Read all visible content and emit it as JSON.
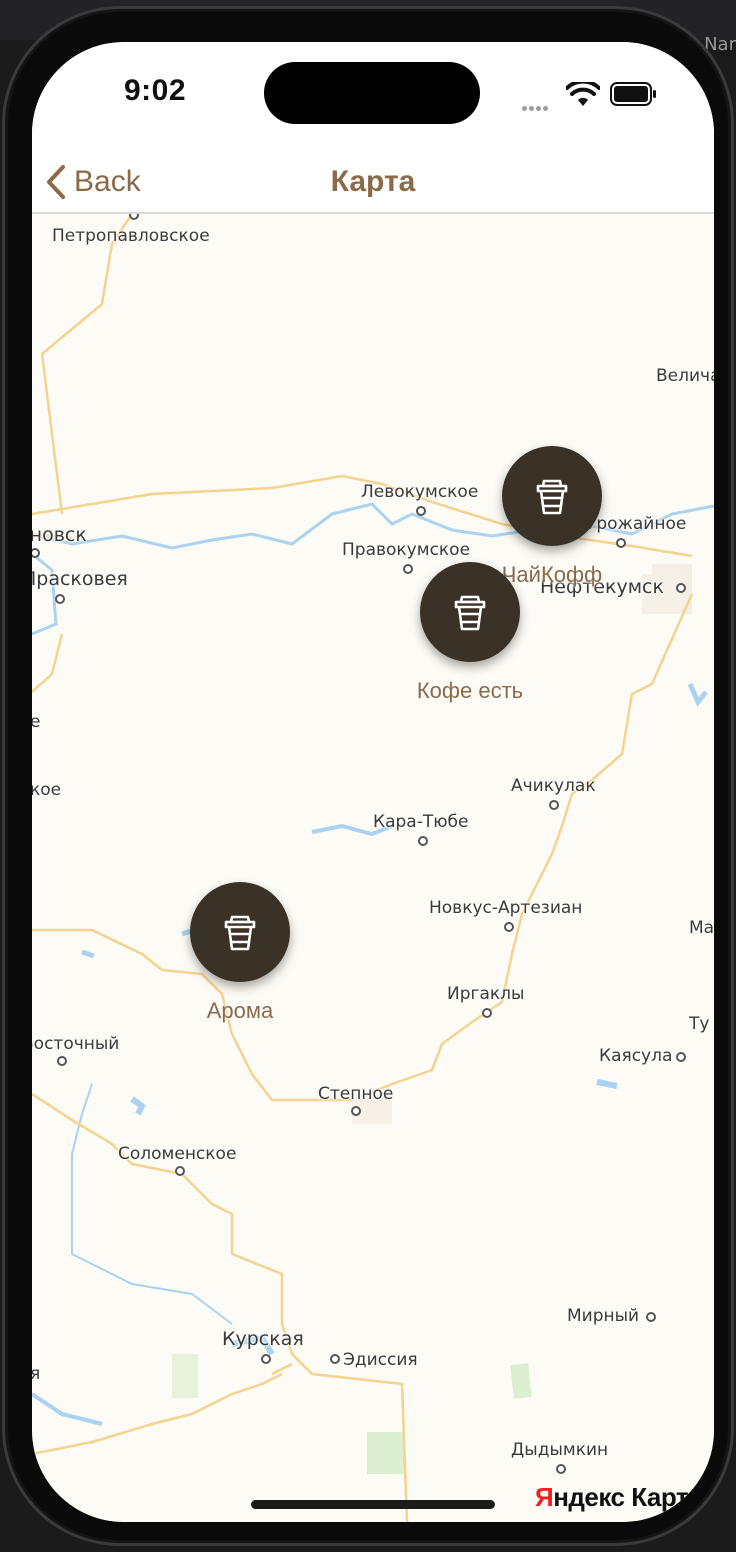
{
  "background": {
    "right_edge_fragment": "Nar"
  },
  "status_bar": {
    "time": "9:02"
  },
  "nav": {
    "back_label": "Back",
    "title": "Карта"
  },
  "map": {
    "places": {
      "petropavlovskoe": "Петропавловское",
      "velicha": "Велича",
      "levokumskoe": "Левокумское",
      "pravokumskoe": "Правокумское",
      "novsk": "ановск",
      "praskoveya": "Прасковея",
      "urozhaynoe": "Урожайное",
      "neftekumsk": "Нефтекумск",
      "e_frag": "е",
      "koe_frag": "кое",
      "achikulak": "Ачикулак",
      "kara_tyube": "Кара-Тюбе",
      "novkus_artezian": "Новкус-Артезиан",
      "ma_frag": "Ма",
      "irgakly": "Иргаклы",
      "tu_frag": "Ту",
      "vostochny": "Восточный",
      "kayasula": "Каясула",
      "stepnoe": "Степное",
      "solomenskoe": "Соломенское",
      "mirny": "Мирный",
      "kurskaya": "Курская",
      "edissiya": "Эдиссия",
      "ya_frag": "я",
      "dydymkin": "Дыдымкин"
    },
    "pins": [
      {
        "label": "ЧайКофф",
        "icon": "coffee-cup-icon"
      },
      {
        "label": "Кофе есть",
        "icon": "coffee-cup-icon"
      },
      {
        "label": "Арома",
        "icon": "coffee-cup-icon"
      }
    ],
    "attribution": {
      "ya": "Я",
      "rest": "ндекс Карты"
    }
  },
  "colors": {
    "accent": "#8a6a48",
    "pin_fill": "#3a3227",
    "map_background": "#fdfbf5",
    "road": "#f3d38e",
    "water": "#a9d3f0"
  }
}
